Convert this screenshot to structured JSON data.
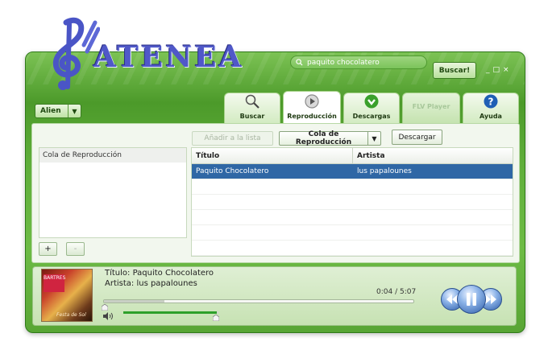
{
  "app": {
    "logo_text": "ATENEA"
  },
  "search": {
    "value": "paquito chocolatero",
    "button_label": "Buscar!"
  },
  "window_controls": [
    "_",
    "□",
    "×"
  ],
  "skin_dropdown": {
    "selected": "Alien"
  },
  "tabs": [
    {
      "label": "Buscar",
      "icon": "magnifier-icon",
      "active": false,
      "disabled": false
    },
    {
      "label": "Reproducción",
      "icon": "play-circle-icon",
      "active": true,
      "disabled": false
    },
    {
      "label": "Descargas",
      "icon": "download-icon",
      "active": false,
      "disabled": false
    },
    {
      "label": "FLV Player",
      "icon": "",
      "active": false,
      "disabled": true
    },
    {
      "label": "Ayuda",
      "icon": "help-icon",
      "active": false,
      "disabled": false
    }
  ],
  "toolbar": {
    "add_to_list_label": "Añadir a la lista",
    "list_select": "Cola de Reproducción",
    "download_label": "Descargar"
  },
  "side_list": {
    "header": "Cola de Reproducción",
    "add_label": "+",
    "remove_label": "-"
  },
  "table": {
    "columns": [
      "Título",
      "Artista"
    ],
    "rows": [
      {
        "title": "Paquito Chocolatero",
        "artist": "lus papalounes",
        "selected": true
      }
    ]
  },
  "player": {
    "title_line": "Título: Paquito Chocolatero",
    "artist_line": "Artista: lus papalounes",
    "time": "0:04 / 5:07",
    "progress": 0.013,
    "volume": 0.98,
    "cover_title": "BARTRES",
    "cover_sub": "Festa de Sol"
  },
  "colors": {
    "accent_green": "#5fae3a",
    "selection_blue": "#2f67a5",
    "logo_blue": "#5058c8"
  }
}
